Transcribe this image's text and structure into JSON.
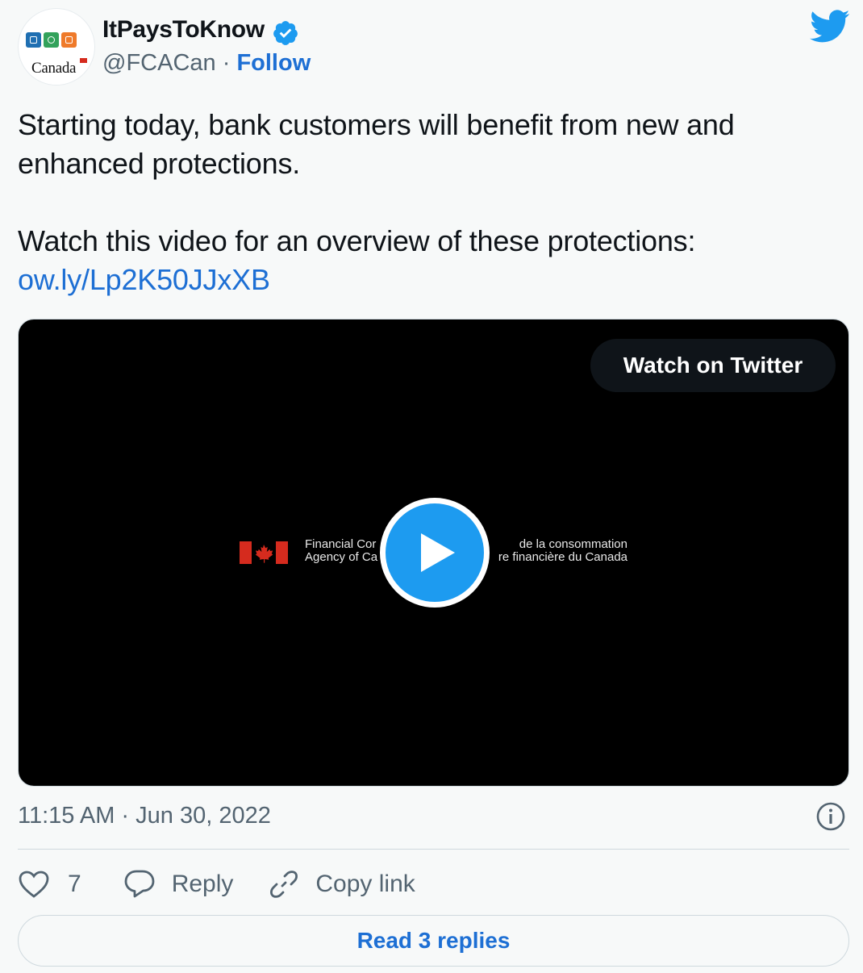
{
  "author": {
    "display_name": "ItPaysToKnow",
    "handle": "@FCACan",
    "separator": "·",
    "follow_label": "Follow",
    "avatar_wordmark": "Canada"
  },
  "tweet": {
    "paragraphs": [
      "Starting today, bank customers will benefit from new and enhanced protections.",
      "Watch this video for an overview of these protections:"
    ],
    "link_text": "ow.ly/Lp2K50JJxXB"
  },
  "media": {
    "watch_label": "Watch on Twitter",
    "agency_line1_left": "Financial Cor",
    "agency_line1_right": "de la consommation",
    "agency_line2_left": "Agency of Ca",
    "agency_line2_right": "re financière du Canada"
  },
  "meta": {
    "timestamp": "11:15 AM · Jun 30, 2022"
  },
  "actions": {
    "like_count": "7",
    "reply_label": "Reply",
    "copy_link_label": "Copy link"
  },
  "read_replies_label": "Read 3 replies",
  "colors": {
    "accent_link": "#1d6fd4",
    "twitter_blue": "#1d9bf0",
    "text_secondary": "#536471",
    "flag_red": "#d52b1e"
  },
  "icons": [
    "verified-badge-icon",
    "twitter-bird-icon",
    "play-icon",
    "info-icon",
    "heart-icon",
    "reply-bubble-icon",
    "link-icon",
    "maple-leaf-icon"
  ]
}
